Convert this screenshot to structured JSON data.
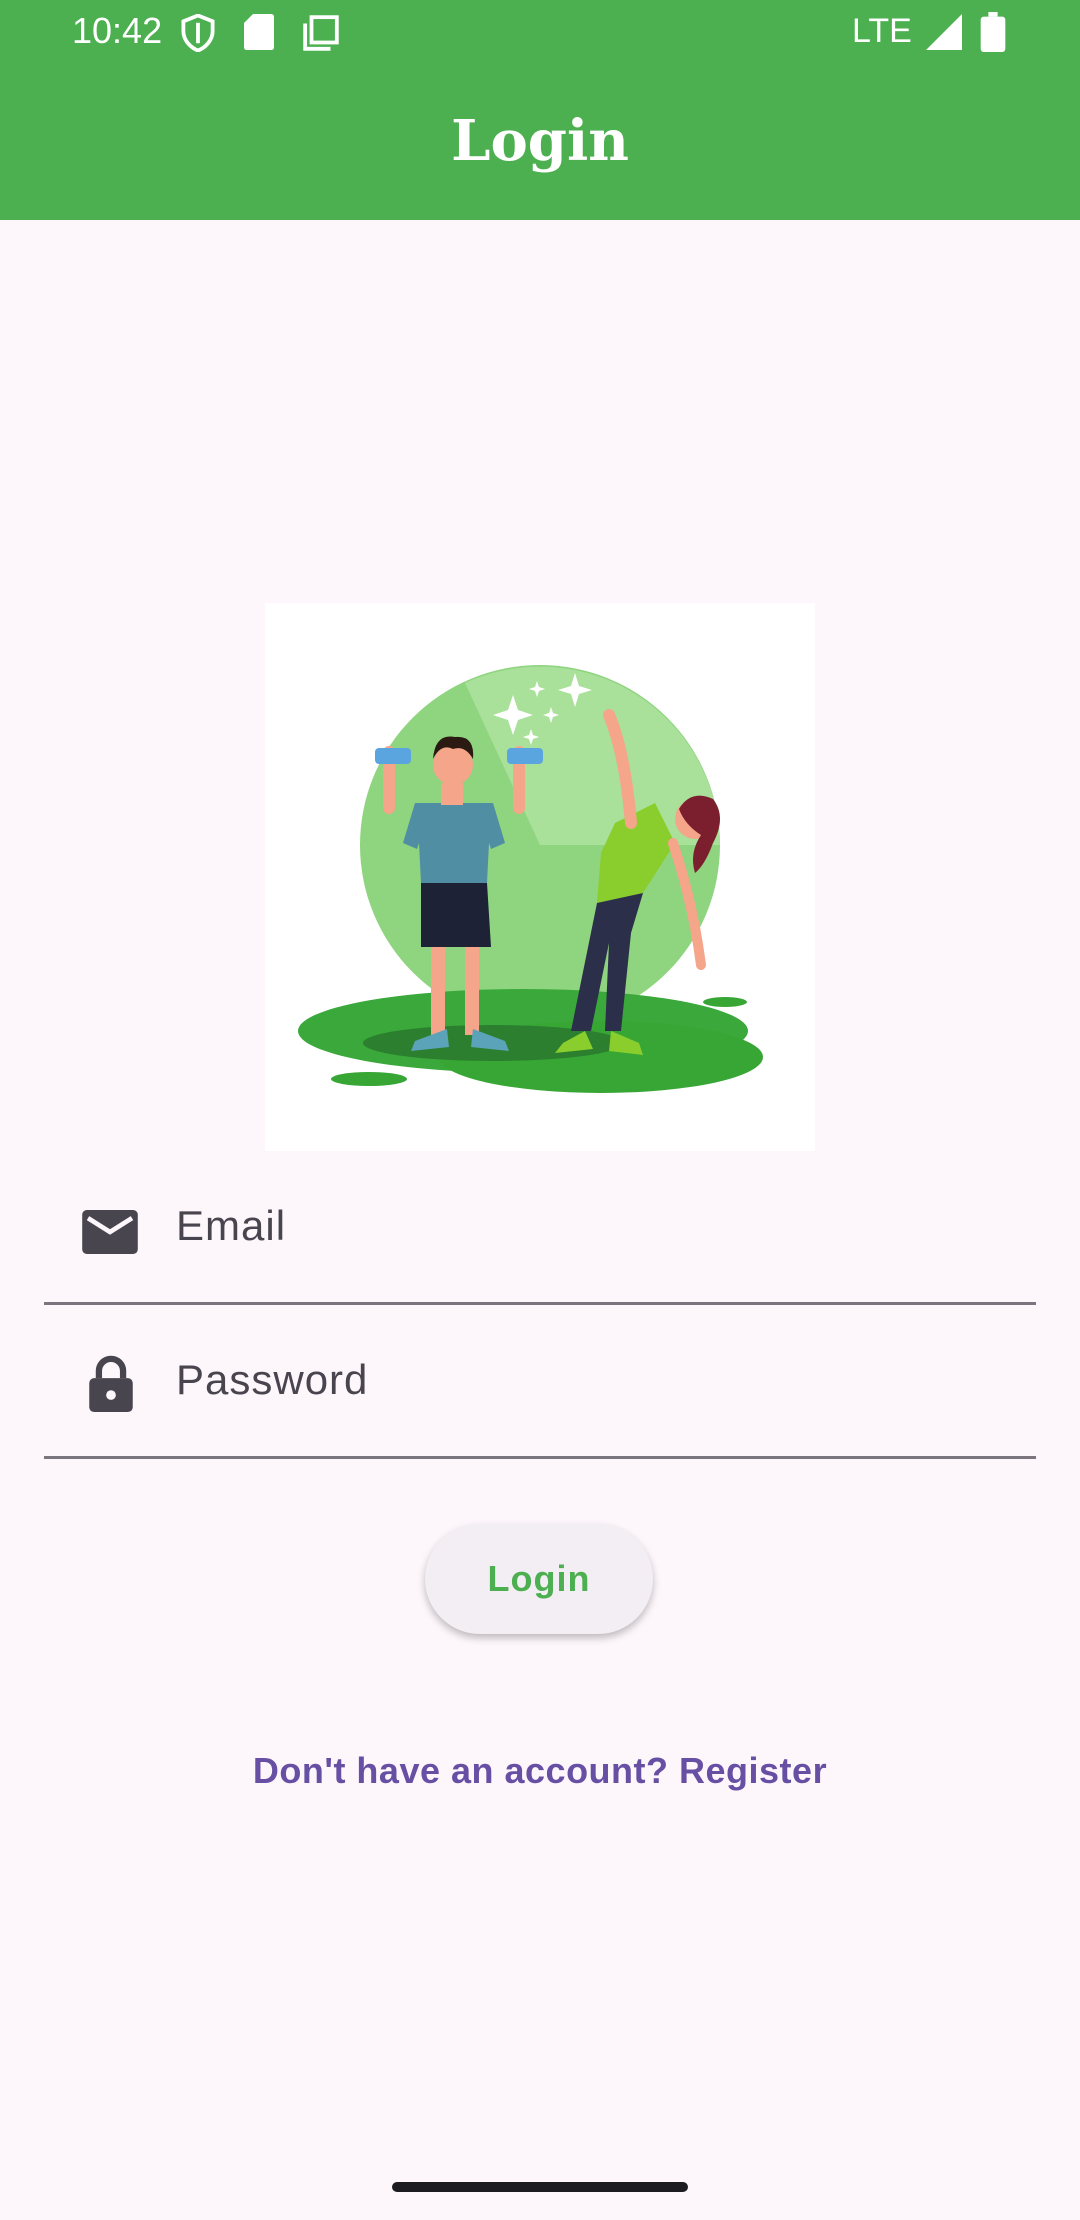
{
  "status_bar": {
    "time": "10:42",
    "network": "LTE",
    "icons": [
      "shield-icon",
      "sd-card-icon",
      "screenshot-icon",
      "signal-icon",
      "battery-icon"
    ]
  },
  "app_bar": {
    "title": "Login",
    "color": "#4caf50"
  },
  "hero": {
    "icon": "fitness-illustration"
  },
  "form": {
    "email": {
      "placeholder": "Email",
      "icon": "email-icon"
    },
    "password": {
      "placeholder": "Password",
      "icon": "lock-icon"
    },
    "login_label": "Login",
    "register_label": "Don't have an account? Register"
  },
  "colors": {
    "accent": "#4caf50",
    "link": "#6750a4",
    "background": "#fdf7fc"
  }
}
